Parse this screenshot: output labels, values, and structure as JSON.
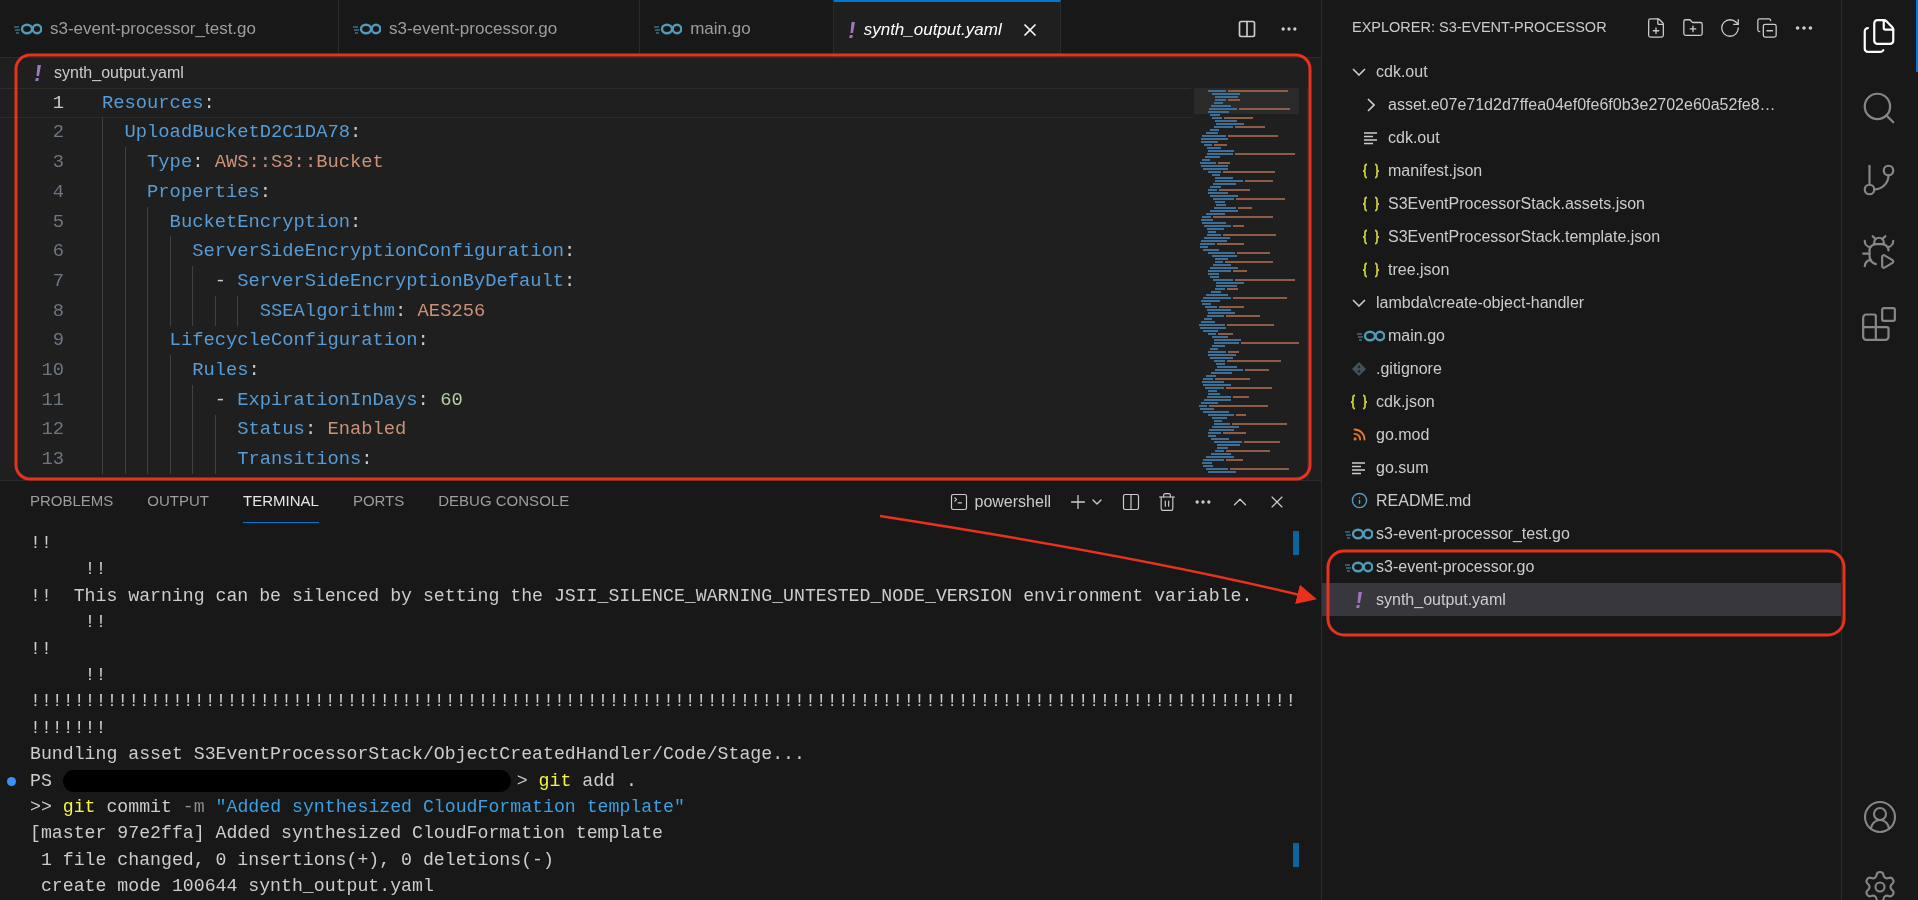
{
  "tabs": [
    {
      "label": "s3-event-processor_test.go",
      "kind": "go",
      "selected": false
    },
    {
      "label": "s3-event-processor.go",
      "kind": "go",
      "selected": false
    },
    {
      "label": "main.go",
      "kind": "go",
      "selected": false
    },
    {
      "label": "synth_output.yaml",
      "kind": "yaml",
      "selected": true
    }
  ],
  "breadcrumb": {
    "label": "synth_output.yaml",
    "kind": "yaml"
  },
  "editor": {
    "lines": [
      {
        "number": "1",
        "current": true,
        "tokens": [
          {
            "kind": "key",
            "text": "Resources"
          },
          {
            "kind": "punct",
            "text": ":"
          }
        ]
      },
      {
        "number": "2",
        "current": false,
        "tokens": [
          {
            "kind": "key",
            "text": "  UploadBucketD2C1DA78"
          },
          {
            "kind": "punct",
            "text": ":"
          }
        ]
      },
      {
        "number": "3",
        "current": false,
        "tokens": [
          {
            "kind": "key",
            "text": "    Type"
          },
          {
            "kind": "punct",
            "text": ": "
          },
          {
            "kind": "string",
            "text": "AWS::S3::Bucket"
          }
        ]
      },
      {
        "number": "4",
        "current": false,
        "tokens": [
          {
            "kind": "key",
            "text": "    Properties"
          },
          {
            "kind": "punct",
            "text": ":"
          }
        ]
      },
      {
        "number": "5",
        "current": false,
        "tokens": [
          {
            "kind": "key",
            "text": "      BucketEncryption"
          },
          {
            "kind": "punct",
            "text": ":"
          }
        ]
      },
      {
        "number": "6",
        "current": false,
        "tokens": [
          {
            "kind": "key",
            "text": "        ServerSideEncryptionConfiguration"
          },
          {
            "kind": "punct",
            "text": ":"
          }
        ]
      },
      {
        "number": "7",
        "current": false,
        "tokens": [
          {
            "kind": "punct",
            "text": "          - "
          },
          {
            "kind": "key",
            "text": "ServerSideEncryptionByDefault"
          },
          {
            "kind": "punct",
            "text": ":"
          }
        ]
      },
      {
        "number": "8",
        "current": false,
        "tokens": [
          {
            "kind": "key",
            "text": "              SSEAlgorithm"
          },
          {
            "kind": "punct",
            "text": ": "
          },
          {
            "kind": "string",
            "text": "AES256"
          }
        ]
      },
      {
        "number": "9",
        "current": false,
        "tokens": [
          {
            "kind": "key",
            "text": "      LifecycleConfiguration"
          },
          {
            "kind": "punct",
            "text": ":"
          }
        ]
      },
      {
        "number": "10",
        "current": false,
        "tokens": [
          {
            "kind": "key",
            "text": "        Rules"
          },
          {
            "kind": "punct",
            "text": ":"
          }
        ]
      },
      {
        "number": "11",
        "current": false,
        "tokens": [
          {
            "kind": "punct",
            "text": "          - "
          },
          {
            "kind": "key",
            "text": "ExpirationInDays"
          },
          {
            "kind": "punct",
            "text": ": "
          },
          {
            "kind": "number",
            "text": "60"
          }
        ]
      },
      {
        "number": "12",
        "current": false,
        "tokens": [
          {
            "kind": "key",
            "text": "            Status"
          },
          {
            "kind": "punct",
            "text": ": "
          },
          {
            "kind": "string",
            "text": "Enabled"
          }
        ]
      },
      {
        "number": "13",
        "current": false,
        "tokens": [
          {
            "kind": "key",
            "text": "            Transitions"
          },
          {
            "kind": "punct",
            "text": ":"
          }
        ]
      }
    ]
  },
  "panel": {
    "tabs": [
      {
        "label": "PROBLEMS",
        "selected": false
      },
      {
        "label": "OUTPUT",
        "selected": false
      },
      {
        "label": "TERMINAL",
        "selected": true
      },
      {
        "label": "PORTS",
        "selected": false
      },
      {
        "label": "DEBUG CONSOLE",
        "selected": false
      }
    ],
    "terminal_name": "powershell",
    "lines": [
      [
        {
          "kind": "plain",
          "text": "!!"
        }
      ],
      [
        {
          "kind": "plain",
          "text": "     !!"
        }
      ],
      [
        {
          "kind": "plain",
          "text": "!!  This warning can be silenced by setting the JSII_SILENCE_WARNING_UNTESTED_NODE_VERSION environment variable."
        }
      ],
      [
        {
          "kind": "plain",
          "text": "     !!"
        }
      ],
      [
        {
          "kind": "plain",
          "text": "!!"
        }
      ],
      [
        {
          "kind": "plain",
          "text": "     !!"
        }
      ],
      [
        {
          "kind": "plain",
          "text": "!!!!!!!!!!!!!!!!!!!!!!!!!!!!!!!!!!!!!!!!!!!!!!!!!!!!!!!!!!!!!!!!!!!!!!!!!!!!!!!!!!!!!!!!!!!!!!!!!!!!!!!!!!!!!!!!!!!!"
        }
      ],
      [
        {
          "kind": "plain",
          "text": "!!!!!!!"
        }
      ],
      [
        {
          "kind": "plain",
          "text": "Bundling asset S3EventProcessorStack/ObjectCreatedHandler/Code/Stage..."
        }
      ],
      [
        {
          "kind": "prompt-dot"
        },
        {
          "kind": "plain",
          "text": "PS "
        },
        {
          "kind": "redaction"
        },
        {
          "kind": "plain",
          "text": "> "
        },
        {
          "kind": "command",
          "text": "git"
        },
        {
          "kind": "plain",
          "text": " add ."
        }
      ],
      [
        {
          "kind": "plain",
          "text": ">> "
        },
        {
          "kind": "command",
          "text": "git"
        },
        {
          "kind": "plain",
          "text": " commit "
        },
        {
          "kind": "flag",
          "text": "-m "
        },
        {
          "kind": "string",
          "text": "\"Added synthesized CloudFormation template\""
        }
      ],
      [
        {
          "kind": "plain",
          "text": "[master 97e2ffa] Added synthesized CloudFormation template"
        }
      ],
      [
        {
          "kind": "plain",
          "text": " 1 file changed, 0 insertions(+), 0 deletions(-)"
        }
      ],
      [
        {
          "kind": "plain",
          "text": " create mode 100644 synth_output.yaml"
        }
      ]
    ]
  },
  "explorer": {
    "title": "EXPLORER: S3-EVENT-PROCESSOR",
    "items": [
      {
        "label": "cdk.out",
        "kind": "folder",
        "expanded": true,
        "selected": false,
        "children": [
          {
            "label": "asset.e07e71d2d7ffea04ef0fe6f0b3e2702e60a52fe8…",
            "kind": "folder",
            "expanded": false,
            "selected": false
          },
          {
            "label": "cdk.out",
            "kind": "lines",
            "selected": false
          },
          {
            "label": "manifest.json",
            "kind": "json",
            "selected": false
          },
          {
            "label": "S3EventProcessorStack.assets.json",
            "kind": "json",
            "selected": false
          },
          {
            "label": "S3EventProcessorStack.template.json",
            "kind": "json",
            "selected": false
          },
          {
            "label": "tree.json",
            "kind": "json",
            "selected": false
          }
        ]
      },
      {
        "label": "lambda\\create-object-handler",
        "kind": "folder",
        "expanded": true,
        "selected": false,
        "children": [
          {
            "label": "main.go",
            "kind": "go",
            "selected": false
          }
        ]
      },
      {
        "label": ".gitignore",
        "kind": "git",
        "selected": false
      },
      {
        "label": "cdk.json",
        "kind": "json",
        "selected": false
      },
      {
        "label": "go.mod",
        "kind": "feed",
        "selected": false
      },
      {
        "label": "go.sum",
        "kind": "lines",
        "selected": false
      },
      {
        "label": "README.md",
        "kind": "info",
        "selected": false
      },
      {
        "label": "s3-event-processor_test.go",
        "kind": "go",
        "selected": false
      },
      {
        "label": "s3-event-processor.go",
        "kind": "go",
        "selected": false
      },
      {
        "label": "synth_output.yaml",
        "kind": "yaml",
        "selected": true
      }
    ]
  },
  "activity_bar": {
    "top": [
      {
        "kind": "explorer",
        "selected": true
      },
      {
        "kind": "search",
        "selected": false
      },
      {
        "kind": "source-control",
        "selected": false
      },
      {
        "kind": "run-debug",
        "selected": false
      },
      {
        "kind": "extensions",
        "selected": false
      }
    ],
    "bottom": [
      {
        "kind": "accounts"
      },
      {
        "kind": "settings"
      }
    ]
  }
}
